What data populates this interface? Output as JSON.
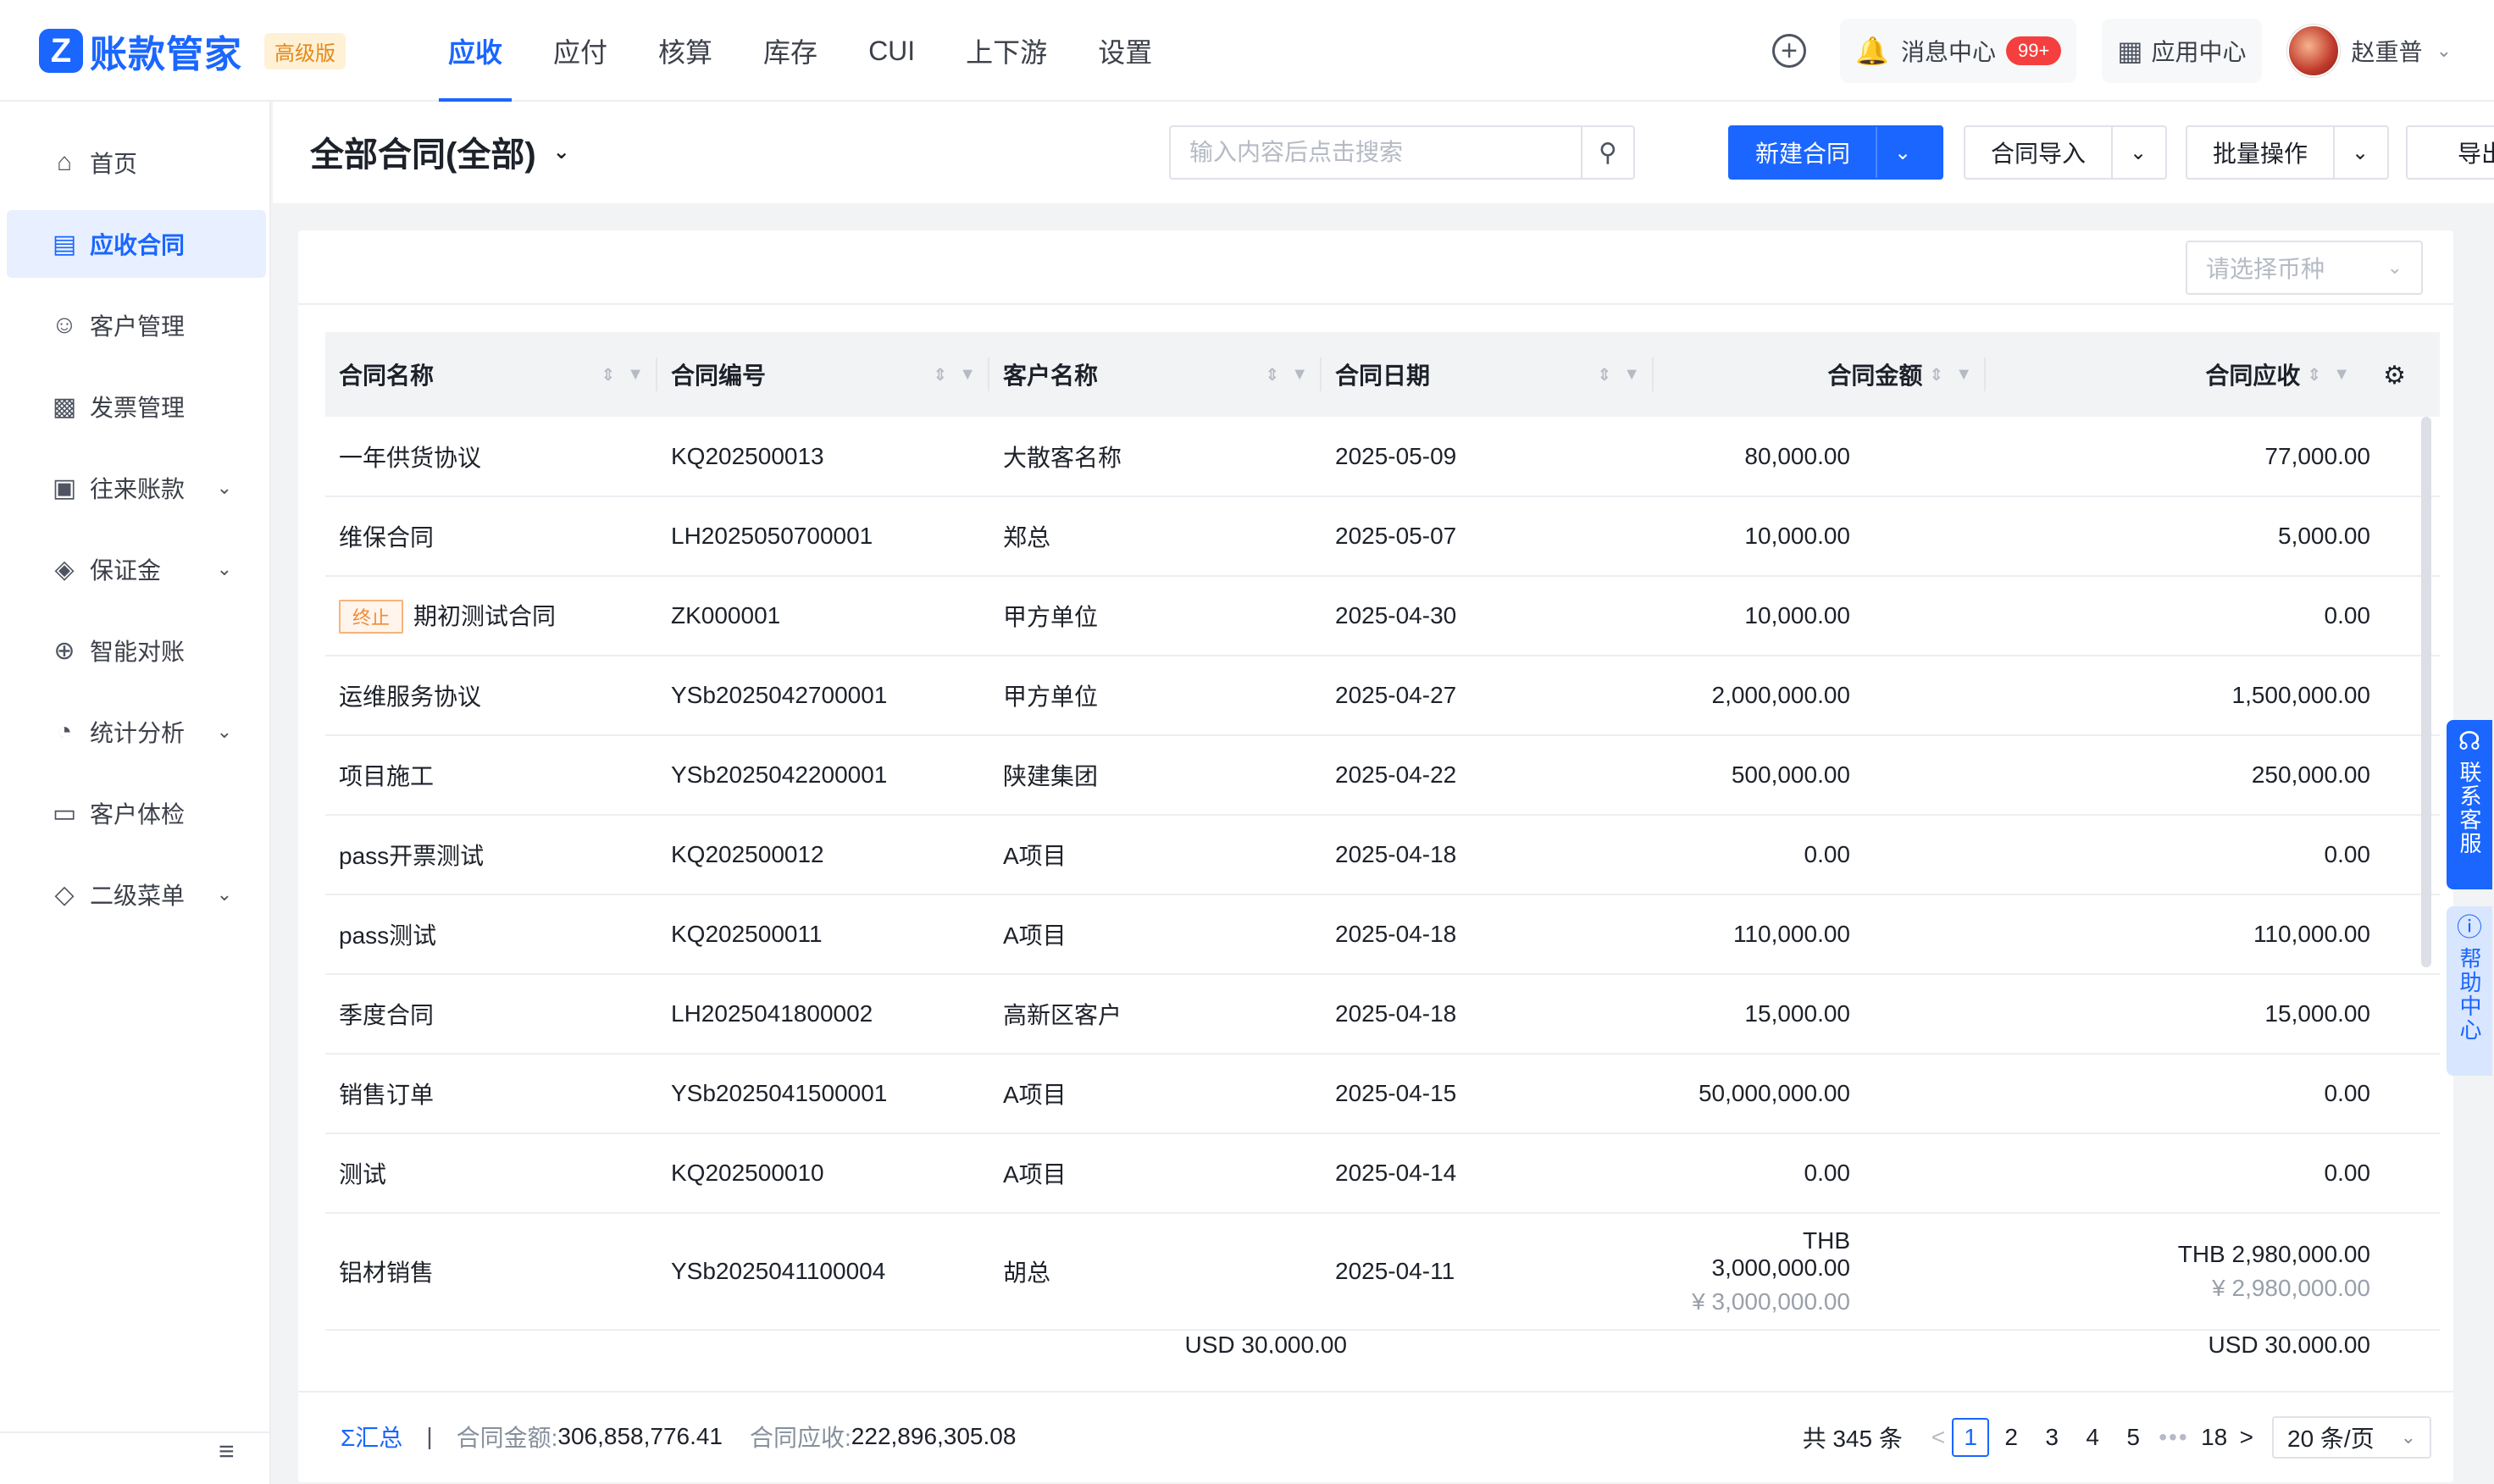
{
  "app": {
    "logo_mark": "Z",
    "name": "账款管家",
    "edition": "高级版"
  },
  "nav": [
    {
      "label": "应收",
      "active": true
    },
    {
      "label": "应付"
    },
    {
      "label": "核算"
    },
    {
      "label": "库存"
    },
    {
      "label": "CUI"
    },
    {
      "label": "上下游"
    },
    {
      "label": "设置"
    }
  ],
  "topright": {
    "messages_label": "消息中心",
    "messages_badge": "99+",
    "apps_label": "应用中心",
    "user_name": "赵重普"
  },
  "sidebar": {
    "items": [
      {
        "label": "首页",
        "icon": "home-icon"
      },
      {
        "label": "应收合同",
        "icon": "contract-icon",
        "active": true
      },
      {
        "label": "客户管理",
        "icon": "user-icon"
      },
      {
        "label": "发票管理",
        "icon": "invoice-icon"
      },
      {
        "label": "往来账款",
        "icon": "wallet-icon",
        "expand": true
      },
      {
        "label": "保证金",
        "icon": "shield-icon",
        "expand": true
      },
      {
        "label": "智能对账",
        "icon": "reconcile-icon"
      },
      {
        "label": "统计分析",
        "icon": "pie-chart-icon",
        "expand": true
      },
      {
        "label": "客户体检",
        "icon": "monitor-icon"
      },
      {
        "label": "二级菜单",
        "icon": "tag-icon",
        "expand": true
      }
    ]
  },
  "page": {
    "title": "全部合同(全部)"
  },
  "toolbar": {
    "search_placeholder": "输入内容后点击搜索",
    "new_contract": "新建合同",
    "import": "合同导入",
    "batch": "批量操作",
    "export": "导出"
  },
  "currency": {
    "placeholder": "请选择币种"
  },
  "table": {
    "headers": [
      "合同名称",
      "合同编号",
      "客户名称",
      "合同日期",
      "合同金额",
      "合同应收"
    ],
    "rows": [
      {
        "name": "一年供货协议",
        "no": "KQ202500013",
        "customer": "大散客名称",
        "date": "2025-05-09",
        "amount": "80,000.00",
        "receivable": "77,000.00"
      },
      {
        "name": "维保合同",
        "no": "LH2025050700001",
        "customer": "郑总",
        "date": "2025-05-07",
        "amount": "10,000.00",
        "receivable": "5,000.00"
      },
      {
        "tag": "终止",
        "name": "期初测试合同",
        "no": "ZK000001",
        "customer": "甲方单位",
        "date": "2025-04-30",
        "amount": "10,000.00",
        "receivable": "0.00"
      },
      {
        "name": "运维服务协议",
        "no": "YSb2025042700001",
        "customer": "甲方单位",
        "date": "2025-04-27",
        "amount": "2,000,000.00",
        "receivable": "1,500,000.00"
      },
      {
        "name": "项目施工",
        "no": "YSb2025042200001",
        "customer": "陕建集团",
        "date": "2025-04-22",
        "amount": "500,000.00",
        "receivable": "250,000.00"
      },
      {
        "name": "pass开票测试",
        "no": "KQ202500012",
        "customer": "A项目",
        "date": "2025-04-18",
        "amount": "0.00",
        "receivable": "0.00"
      },
      {
        "name": "pass测试",
        "no": "KQ202500011",
        "customer": "A项目",
        "date": "2025-04-18",
        "amount": "110,000.00",
        "receivable": "110,000.00"
      },
      {
        "name": "季度合同",
        "no": "LH2025041800002",
        "customer": "高新区客户",
        "date": "2025-04-18",
        "amount": "15,000.00",
        "receivable": "15,000.00"
      },
      {
        "name": "销售订单",
        "no": "YSb2025041500001",
        "customer": "A项目",
        "date": "2025-04-15",
        "amount": "50,000,000.00",
        "receivable": "0.00"
      },
      {
        "name": "测试",
        "no": "KQ202500010",
        "customer": "A项目",
        "date": "2025-04-14",
        "amount": "0.00",
        "receivable": "0.00"
      },
      {
        "name": "铝材销售",
        "no": "YSb2025041100004",
        "customer": "胡总",
        "date": "2025-04-11",
        "amount": "THB 3,000,000.00",
        "amount_sub": "¥ 3,000,000.00",
        "receivable": "THB 2,980,000.00",
        "receivable_sub": "¥ 2,980,000.00"
      }
    ],
    "partial_amount": "USD 30,000.00",
    "partial_receivable": "USD 30,000.00"
  },
  "footer": {
    "sum_label": "Σ汇总",
    "amount_key": "合同金额:",
    "amount_val": "306,858,776.41",
    "receivable_key": "合同应收:",
    "receivable_val": "222,896,305.08",
    "total": "共 345 条",
    "pages": [
      "1",
      "2",
      "3",
      "4",
      "5"
    ],
    "dots": "•••",
    "last_page": "18",
    "page_size": "20 条/页"
  },
  "float": {
    "cs": "联系客服",
    "help": "帮助中心"
  }
}
